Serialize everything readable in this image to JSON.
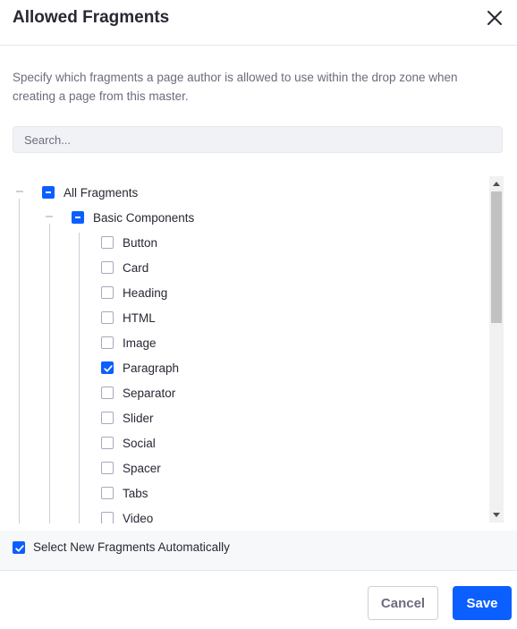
{
  "modal": {
    "title": "Allowed Fragments",
    "description": "Specify which fragments a page author is allowed to use within the drop zone when creating a page from this master."
  },
  "search": {
    "placeholder": "Search...",
    "value": ""
  },
  "tree": {
    "root": {
      "label": "All Fragments",
      "state": "indeterminate",
      "expanded": true
    },
    "group": {
      "label": "Basic Components",
      "state": "indeterminate",
      "expanded": true
    },
    "items": [
      {
        "label": "Button",
        "checked": false
      },
      {
        "label": "Card",
        "checked": false
      },
      {
        "label": "Heading",
        "checked": false
      },
      {
        "label": "HTML",
        "checked": false
      },
      {
        "label": "Image",
        "checked": false
      },
      {
        "label": "Paragraph",
        "checked": true
      },
      {
        "label": "Separator",
        "checked": false
      },
      {
        "label": "Slider",
        "checked": false
      },
      {
        "label": "Social",
        "checked": false
      },
      {
        "label": "Spacer",
        "checked": false
      },
      {
        "label": "Tabs",
        "checked": false
      },
      {
        "label": "Video",
        "checked": false
      }
    ]
  },
  "auto_select": {
    "label": "Select New Fragments Automatically",
    "checked": true
  },
  "footer": {
    "cancel_label": "Cancel",
    "save_label": "Save"
  },
  "colors": {
    "primary": "#0b5fff",
    "text": "#272833",
    "muted": "#6b6c7e",
    "border": "#cdced9"
  },
  "icons": {
    "close": "close-icon",
    "collapse": "collapse-minus-icon",
    "check": "check-icon"
  }
}
